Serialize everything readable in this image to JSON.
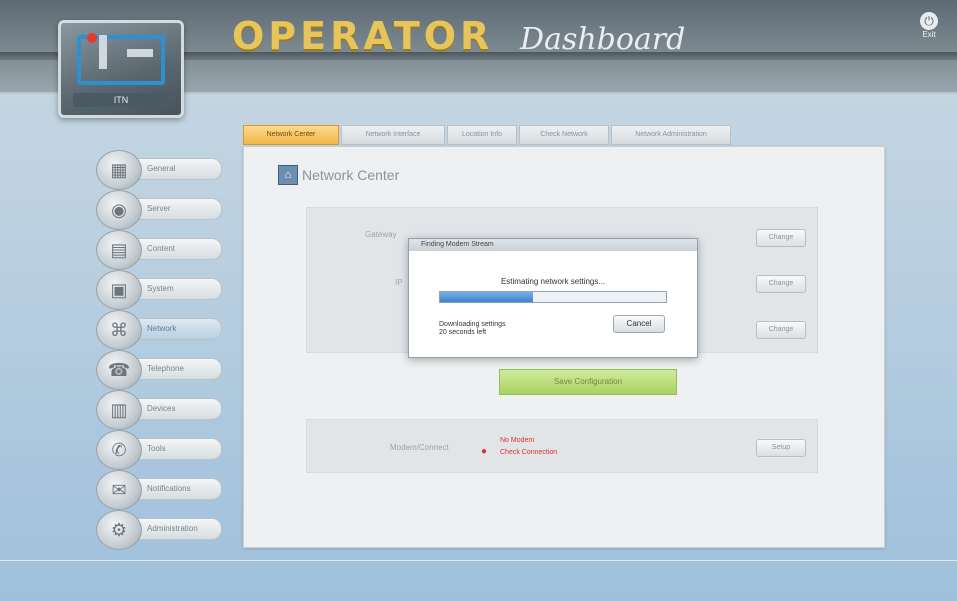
{
  "header": {
    "title_main": "OPERATOR",
    "title_script": "Dashboard",
    "logo_text": "ITN",
    "exit_label": "Exit"
  },
  "sidebar": {
    "items": [
      {
        "label": "General",
        "icon": "general-icon"
      },
      {
        "label": "Server",
        "icon": "server-icon"
      },
      {
        "label": "Content",
        "icon": "content-icon"
      },
      {
        "label": "System",
        "icon": "system-icon"
      },
      {
        "label": "Network",
        "icon": "network-icon"
      },
      {
        "label": "Telephone",
        "icon": "telephone-icon"
      },
      {
        "label": "Devices",
        "icon": "devices-icon"
      },
      {
        "label": "Tools",
        "icon": "tools-icon"
      },
      {
        "label": "Notifications",
        "icon": "notifications-icon"
      },
      {
        "label": "Administration",
        "icon": "administration-icon"
      }
    ],
    "active_index": 4
  },
  "tabs": [
    {
      "label": "Network Center"
    },
    {
      "label": "Network Interface"
    },
    {
      "label": "Location Info"
    },
    {
      "label": "Check Network"
    },
    {
      "label": "Network Administration"
    }
  ],
  "panel": {
    "title": "Network Center",
    "rows": [
      {
        "label": "Gateway",
        "button": "Change"
      },
      {
        "label": "IP",
        "button": "Change"
      },
      {
        "label": "",
        "button": "Change"
      }
    ],
    "green_button": "Save Configuration",
    "modem": {
      "label": "Modem/Connect",
      "status_line1": "No Modem",
      "status_line2": "Check Connection",
      "button": "Setup"
    }
  },
  "dialog": {
    "title": "Finding Modem Stream",
    "message": "Estimating network settings...",
    "progress_fraction": 0.41,
    "detail_line1": "Downloading settings",
    "detail_line2": "20 seconds left",
    "cancel_label": "Cancel"
  },
  "footer": {
    "text": ""
  },
  "colors": {
    "accent": "#f0b74a",
    "progress": "#3c82cf",
    "error": "#e0312a",
    "success": "#a9d261"
  }
}
